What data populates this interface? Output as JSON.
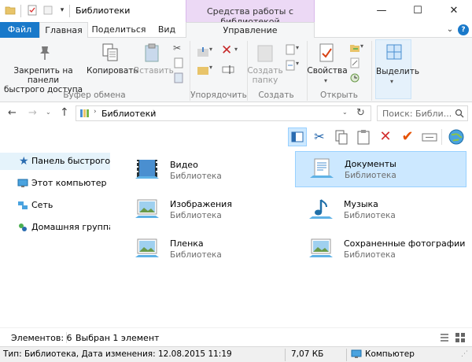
{
  "window": {
    "title": "Библиотеки",
    "context_tab": "Средства работы с библиотекой",
    "controls": {
      "minimize": "—",
      "maximize": "☐",
      "close": "✕"
    }
  },
  "tabs": {
    "file": "Файл",
    "home": "Главная",
    "share": "Поделиться",
    "view": "Вид",
    "manage": "Управление"
  },
  "ribbon": {
    "clipboard": {
      "label": "Буфер обмена",
      "pin": "Закрепить на панели быстрого доступа",
      "pin_line1": "Закрепить на панели",
      "pin_line2": "быстрого доступа",
      "copy": "Копировать",
      "paste": "Вставить"
    },
    "organize": {
      "label": "Упорядочить"
    },
    "create": {
      "label": "Создать",
      "new_folder_line1": "Создать",
      "new_folder_line2": "папку"
    },
    "open": {
      "label": "Открыть",
      "properties": "Свойства"
    },
    "select": {
      "label": "Выделить"
    }
  },
  "address": {
    "path": "Библиотеки",
    "search_placeholder": "Поиск: Библи..."
  },
  "nav": {
    "quick_access": "Панель быстрого доступа",
    "this_pc": "Этот компьютер",
    "network": "Сеть",
    "homegroup": "Домашняя группа"
  },
  "libraries": [
    {
      "name": "Видео",
      "type": "Библиотека"
    },
    {
      "name": "Документы",
      "type": "Библиотека"
    },
    {
      "name": "Изображения",
      "type": "Библиотека"
    },
    {
      "name": "Музыка",
      "type": "Библиотека"
    },
    {
      "name": "Пленка",
      "type": "Библиотека"
    },
    {
      "name": "Сохраненные фотографии",
      "type": "Библиотека"
    }
  ],
  "status": {
    "items": "Элементов: 6",
    "selected": "Выбран 1 элемент"
  },
  "info": {
    "details": "Тип: Библиотека, Дата изменения: 12.08.2015 11:19",
    "size": "7,07 КБ",
    "location": "Компьютер"
  },
  "colors": {
    "accent": "#1979ca",
    "selection": "#cce8ff",
    "context_tab": "#ecd9f5"
  }
}
